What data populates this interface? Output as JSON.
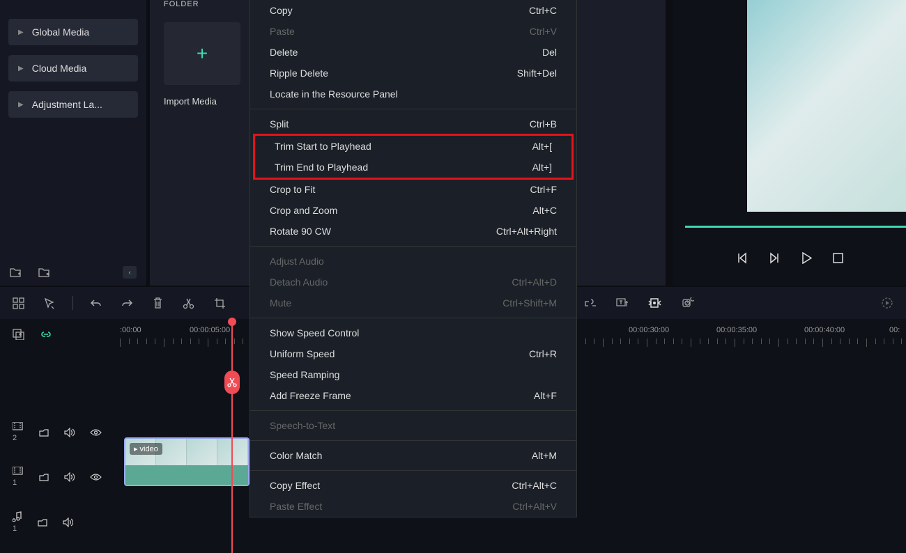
{
  "sidebar": {
    "items": [
      {
        "label": "Global Media"
      },
      {
        "label": "Cloud Media"
      },
      {
        "label": "Adjustment La..."
      }
    ]
  },
  "media": {
    "folder_label": "FOLDER",
    "import_label": "Import Media"
  },
  "context_menu": {
    "groups": [
      [
        {
          "label": "Copy",
          "shortcut": "Ctrl+C",
          "disabled": false
        },
        {
          "label": "Paste",
          "shortcut": "Ctrl+V",
          "disabled": true
        },
        {
          "label": "Delete",
          "shortcut": "Del",
          "disabled": false
        },
        {
          "label": "Ripple Delete",
          "shortcut": "Shift+Del",
          "disabled": false
        },
        {
          "label": "Locate in the Resource Panel",
          "shortcut": "",
          "disabled": false
        }
      ],
      [
        {
          "label": "Split",
          "shortcut": "Ctrl+B",
          "disabled": false
        },
        {
          "label": "Trim Start to Playhead",
          "shortcut": "Alt+[",
          "disabled": false,
          "highlight": true
        },
        {
          "label": "Trim End to Playhead",
          "shortcut": "Alt+]",
          "disabled": false,
          "highlight": true
        },
        {
          "label": "Crop to Fit",
          "shortcut": "Ctrl+F",
          "disabled": false
        },
        {
          "label": "Crop and Zoom",
          "shortcut": "Alt+C",
          "disabled": false
        },
        {
          "label": "Rotate 90 CW",
          "shortcut": "Ctrl+Alt+Right",
          "disabled": false
        }
      ],
      [
        {
          "label": "Adjust Audio",
          "shortcut": "",
          "disabled": true
        },
        {
          "label": "Detach Audio",
          "shortcut": "Ctrl+Alt+D",
          "disabled": true
        },
        {
          "label": "Mute",
          "shortcut": "Ctrl+Shift+M",
          "disabled": true
        }
      ],
      [
        {
          "label": "Show Speed Control",
          "shortcut": "",
          "disabled": false
        },
        {
          "label": "Uniform Speed",
          "shortcut": "Ctrl+R",
          "disabled": false
        },
        {
          "label": "Speed Ramping",
          "shortcut": "",
          "disabled": false
        },
        {
          "label": "Add Freeze Frame",
          "shortcut": "Alt+F",
          "disabled": false
        }
      ],
      [
        {
          "label": "Speech-to-Text",
          "shortcut": "",
          "disabled": true
        }
      ],
      [
        {
          "label": "Color Match",
          "shortcut": "Alt+M",
          "disabled": false
        }
      ],
      [
        {
          "label": "Copy Effect",
          "shortcut": "Ctrl+Alt+C",
          "disabled": false
        },
        {
          "label": "Paste Effect",
          "shortcut": "Ctrl+Alt+V",
          "disabled": true
        }
      ]
    ]
  },
  "timeline": {
    "ruler_ticks": [
      {
        "label": ":00:00",
        "pos": 0
      },
      {
        "label": "00:00:05:00",
        "pos": 126
      },
      {
        "label": "00:00:30:00",
        "pos": 756
      },
      {
        "label": "00:00:35:00",
        "pos": 882
      },
      {
        "label": "00:00:40:00",
        "pos": 1008
      },
      {
        "label": "00:",
        "pos": 1120
      }
    ],
    "tracks": [
      {
        "icon": "video",
        "num": "2"
      },
      {
        "icon": "video",
        "num": "1"
      },
      {
        "icon": "audio",
        "num": "1"
      }
    ],
    "clip_label": "video"
  }
}
